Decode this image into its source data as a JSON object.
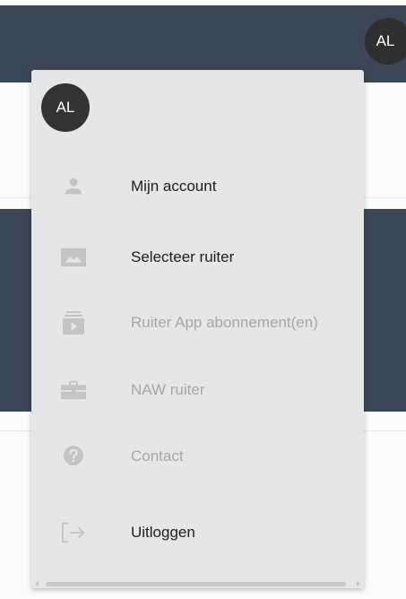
{
  "header": {
    "avatar_initials": "AL",
    "background_color": "#3b4657"
  },
  "menu": {
    "avatar_initials": "AL",
    "items": [
      {
        "label": "Mijn account",
        "icon": "person-icon",
        "enabled": true
      },
      {
        "label": "Selecteer ruiter",
        "icon": "image-icon",
        "enabled": true
      },
      {
        "label": "Ruiter App abonnement(en)",
        "icon": "subscriptions-icon",
        "enabled": false
      },
      {
        "label": "NAW ruiter",
        "icon": "briefcase-icon",
        "enabled": false
      },
      {
        "label": "Contact",
        "icon": "help-icon",
        "enabled": false
      },
      {
        "label": "Uitloggen",
        "icon": "logout-icon",
        "enabled": true
      }
    ]
  },
  "colors": {
    "menu_background": "#e6e6e6",
    "enabled_text": "#1d1d1d",
    "disabled_text": "#a7a7a7",
    "icon": "#c4c4c4"
  }
}
